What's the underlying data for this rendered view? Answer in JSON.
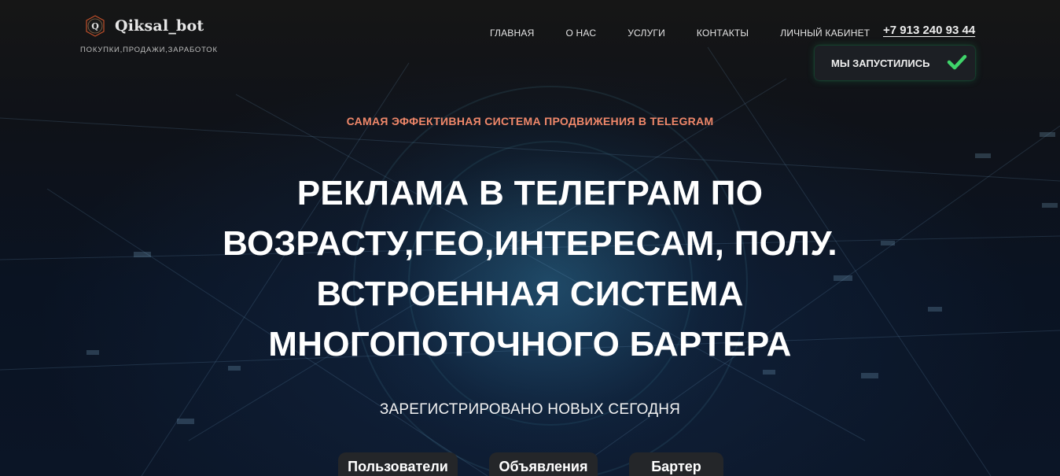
{
  "header": {
    "logo_letter": "Q",
    "logo_name": "Qiksal_bot",
    "logo_tagline": "ПОКУПКИ,ПРОДАЖИ,ЗАРАБОТОК",
    "nav": [
      {
        "label": "ГЛАВНАЯ"
      },
      {
        "label": "О НАС"
      },
      {
        "label": "УСЛУГИ"
      },
      {
        "label": "КОНТАКТЫ"
      },
      {
        "label": "ЛИЧНЫЙ КАБИНЕТ"
      }
    ],
    "phone": "+7 913 240 93 44",
    "launch_badge": {
      "label": "МЫ ЗАПУСТИЛИСЬ",
      "icon": "check-icon",
      "icon_color": "#3fd46a"
    }
  },
  "hero": {
    "eyebrow": "САМАЯ ЭФФЕКТИВНАЯ СИСТЕМА ПРОДВИЖЕНИЯ В TELEGRAM",
    "headline_lines": [
      "РЕКЛАМА В ТЕЛЕГРАМ ПО",
      "ВОЗРАСТУ,ГЕО,ИНТЕРЕСАМ, ПОЛУ.",
      "ВСТРОЕННАЯ СИСТЕМА",
      "МНОГОПОТОЧНОГО БАРТЕРА"
    ],
    "subhead": "ЗАРЕГИСТРИРОВАНО НОВЫХ СЕГОДНЯ",
    "stats": [
      {
        "label": "Пользователи"
      },
      {
        "label": "Объявления"
      },
      {
        "label": "Бартер"
      }
    ]
  },
  "colors": {
    "accent": "#f0886a",
    "check": "#3fd46a"
  }
}
